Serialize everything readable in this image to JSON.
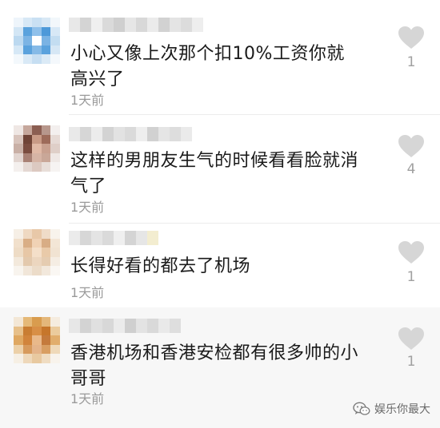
{
  "comments": [
    {
      "text": "小心又像上次那个扣10%工资你就高兴了",
      "time": "1天前",
      "likes": "1",
      "avatar_icon": "blurred-avatar",
      "username_icon": "blurred-username"
    },
    {
      "text": "这样的男朋友生气的时候看看脸就消气了",
      "time": "1天前",
      "likes": "4",
      "avatar_icon": "blurred-avatar",
      "username_icon": "blurred-username"
    },
    {
      "text": "长得好看的都去了机场",
      "time": "1天前",
      "likes": "1",
      "avatar_icon": "blurred-avatar",
      "username_icon": "blurred-username"
    },
    {
      "text": "香港机场和香港安检都有很多帅的小哥哥",
      "time": "1天前",
      "likes": "1",
      "avatar_icon": "blurred-avatar",
      "username_icon": "blurred-username"
    }
  ],
  "watermark": {
    "text": "娱乐你最大",
    "icon": "wechat-icon"
  },
  "colors": {
    "text": "#1a1a1a",
    "time": "#9a9a9a",
    "like_icon": "#d6d6d6",
    "like_count": "#a0a0a0",
    "divider": "#ececec"
  }
}
